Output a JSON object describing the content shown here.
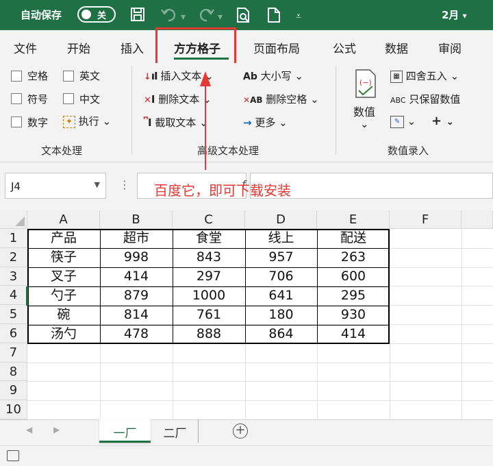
{
  "titlebar": {
    "autosave_label": "自动保存",
    "toggle_state": "关",
    "month": "2月",
    "month_chevron": "▾"
  },
  "tabs": [
    {
      "label": "文件"
    },
    {
      "label": "开始"
    },
    {
      "label": "插入"
    },
    {
      "label": "方方格子"
    },
    {
      "label": "页面布局"
    },
    {
      "label": "公式"
    },
    {
      "label": "数据"
    },
    {
      "label": "审阅"
    }
  ],
  "ribbon": {
    "text_group": {
      "items": [
        "空格",
        "英文",
        "符号",
        "中文",
        "数字",
        "执行"
      ],
      "label": "文本处理"
    },
    "advanced_group": {
      "insert_text": "插入文本",
      "delete_text": "删除文本",
      "extract_text": "截取文本",
      "case": "大小写",
      "delete_space": "删除空格",
      "more": "更多",
      "label": "高级文本处理"
    },
    "value_group": {
      "value": "数值",
      "round": "四舍五入",
      "keep_values": "只保留数值",
      "label": "数值录入"
    },
    "chevron": "⌄"
  },
  "formula_bar": {
    "name_box": "J4",
    "fx_symbol": "f",
    "annotation": "百度它，即可下载安装"
  },
  "sheet": {
    "columns": [
      "A",
      "B",
      "C",
      "D",
      "E",
      "F"
    ],
    "rows": [
      "1",
      "2",
      "3",
      "4",
      "5",
      "6",
      "7",
      "8",
      "9",
      "10"
    ],
    "cells": [
      [
        "产品",
        "超市",
        "食堂",
        "线上",
        "配送"
      ],
      [
        "筷子",
        "998",
        "843",
        "957",
        "263"
      ],
      [
        "叉子",
        "414",
        "297",
        "706",
        "600"
      ],
      [
        "勺子",
        "879",
        "1000",
        "641",
        "295"
      ],
      [
        "碗",
        "814",
        "761",
        "180",
        "930"
      ],
      [
        "汤勺",
        "478",
        "888",
        "864",
        "414"
      ]
    ]
  },
  "sheet_tabs": [
    {
      "label": "一厂"
    },
    {
      "label": "二厂"
    }
  ],
  "add_sheet": "+",
  "colors": {
    "brand": "#1f7145",
    "highlight": "#e53935"
  }
}
